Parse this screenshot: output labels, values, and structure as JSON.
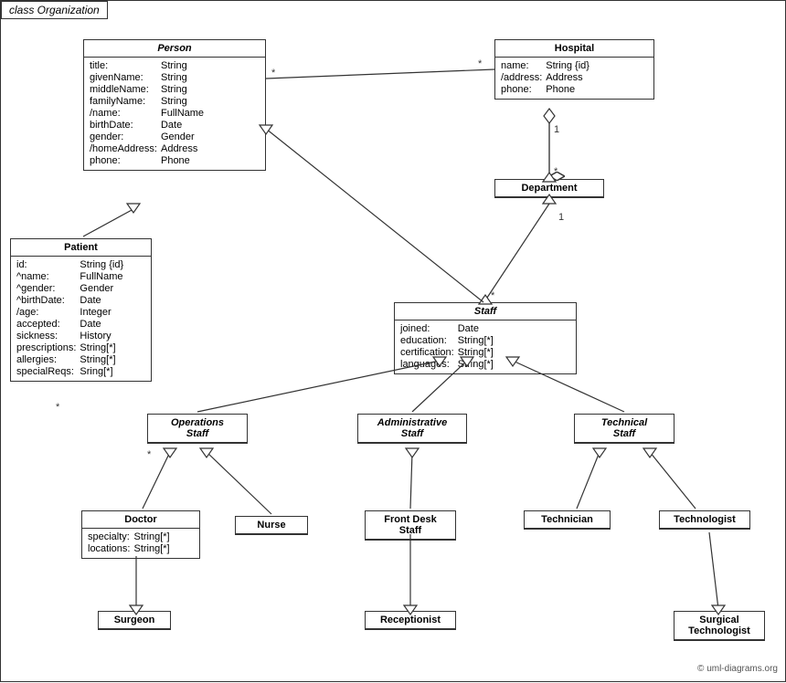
{
  "title": "class Organization",
  "classes": {
    "person": {
      "name": "Person",
      "italic": true,
      "attrs": [
        [
          "title:",
          "String"
        ],
        [
          "givenName:",
          "String"
        ],
        [
          "middleName:",
          "String"
        ],
        [
          "familyName:",
          "String"
        ],
        [
          "/name:",
          "FullName"
        ],
        [
          "birthDate:",
          "Date"
        ],
        [
          "gender:",
          "Gender"
        ],
        [
          "/homeAddress:",
          "Address"
        ],
        [
          "phone:",
          "Phone"
        ]
      ]
    },
    "hospital": {
      "name": "Hospital",
      "italic": false,
      "attrs": [
        [
          "name:",
          "String {id}"
        ],
        [
          "/address:",
          "Address"
        ],
        [
          "phone:",
          "Phone"
        ]
      ]
    },
    "patient": {
      "name": "Patient",
      "italic": false,
      "attrs": [
        [
          "id:",
          "String {id}"
        ],
        [
          "^name:",
          "FullName"
        ],
        [
          "^gender:",
          "Gender"
        ],
        [
          "^birthDate:",
          "Date"
        ],
        [
          "/age:",
          "Integer"
        ],
        [
          "accepted:",
          "Date"
        ],
        [
          "sickness:",
          "History"
        ],
        [
          "prescriptions:",
          "String[*]"
        ],
        [
          "allergies:",
          "String[*]"
        ],
        [
          "specialReqs:",
          "Sring[*]"
        ]
      ]
    },
    "department": {
      "name": "Department",
      "italic": false,
      "attrs": []
    },
    "staff": {
      "name": "Staff",
      "italic": true,
      "attrs": [
        [
          "joined:",
          "Date"
        ],
        [
          "education:",
          "String[*]"
        ],
        [
          "certification:",
          "String[*]"
        ],
        [
          "languages:",
          "String[*]"
        ]
      ]
    },
    "operationsStaff": {
      "name": "Operations\nStaff",
      "italic": true,
      "attrs": []
    },
    "administrativeStaff": {
      "name": "Administrative\nStaff",
      "italic": true,
      "attrs": []
    },
    "technicalStaff": {
      "name": "Technical\nStaff",
      "italic": true,
      "attrs": []
    },
    "doctor": {
      "name": "Doctor",
      "italic": false,
      "attrs": [
        [
          "specialty:",
          "String[*]"
        ],
        [
          "locations:",
          "String[*]"
        ]
      ]
    },
    "nurse": {
      "name": "Nurse",
      "italic": false,
      "attrs": []
    },
    "frontDeskStaff": {
      "name": "Front Desk\nStaff",
      "italic": false,
      "attrs": []
    },
    "technician": {
      "name": "Technician",
      "italic": false,
      "attrs": []
    },
    "technologist": {
      "name": "Technologist",
      "italic": false,
      "attrs": []
    },
    "surgeon": {
      "name": "Surgeon",
      "italic": false,
      "attrs": []
    },
    "receptionist": {
      "name": "Receptionist",
      "italic": false,
      "attrs": []
    },
    "surgicalTechnologist": {
      "name": "Surgical\nTechnologist",
      "italic": false,
      "attrs": []
    }
  },
  "watermark": "© uml-diagrams.org"
}
